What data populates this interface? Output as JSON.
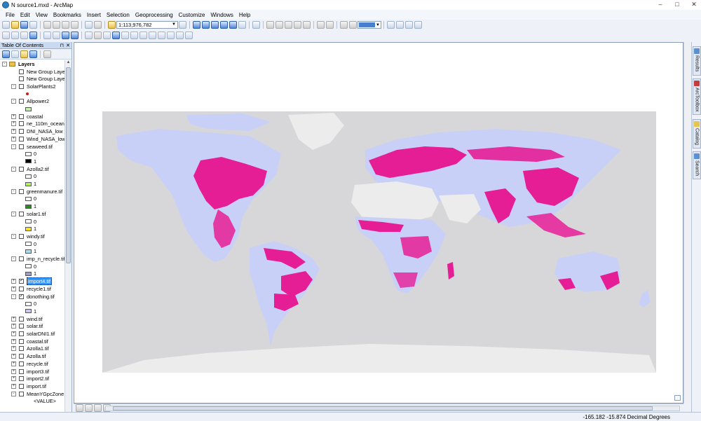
{
  "window": {
    "title": "N source1.mxd - ArcMap",
    "icon": "arcmap-globe-icon"
  },
  "menu": [
    "File",
    "Edit",
    "View",
    "Bookmarks",
    "Insert",
    "Selection",
    "Geoprocessing",
    "Customize",
    "Windows",
    "Help"
  ],
  "toolbar": {
    "scale_value": "1:113,976,782",
    "fill_color": "#4a7fd0"
  },
  "toc": {
    "title": "Table Of Contents",
    "root_label": "Layers",
    "rows": [
      {
        "type": "layer",
        "label": "New Group Layer",
        "checked": false,
        "expander": ""
      },
      {
        "type": "layer",
        "label": "New Group Layer",
        "checked": false,
        "expander": ""
      },
      {
        "type": "layer",
        "label": "SolarPlants2",
        "checked": false,
        "expander": "-"
      },
      {
        "type": "point",
        "color": "#c81e1e"
      },
      {
        "type": "layer",
        "label": "Allpower2",
        "checked": false,
        "expander": "-"
      },
      {
        "type": "swatch",
        "color": "#bff0b0",
        "label": ""
      },
      {
        "type": "layer",
        "label": "coastal",
        "checked": false,
        "expander": "+"
      },
      {
        "type": "layer",
        "label": "ne_110m_ocean",
        "checked": false,
        "expander": "+"
      },
      {
        "type": "layer",
        "label": "DNI_NASA_low",
        "checked": false,
        "expander": "+"
      },
      {
        "type": "layer",
        "label": "Wind_NASA_low",
        "checked": false,
        "expander": "+"
      },
      {
        "type": "layer",
        "label": "seaweed.tif",
        "checked": false,
        "expander": "-"
      },
      {
        "type": "swatch",
        "color": "#ffffff",
        "label": "0"
      },
      {
        "type": "swatch",
        "color": "#000000",
        "label": "1"
      },
      {
        "type": "layer",
        "label": "Azolla2.tif",
        "checked": false,
        "expander": "-"
      },
      {
        "type": "swatch",
        "color": "#ffffff",
        "label": "0"
      },
      {
        "type": "swatch",
        "color": "#b4f064",
        "label": "1"
      },
      {
        "type": "layer",
        "label": "greenmanure.tif",
        "checked": false,
        "expander": "-"
      },
      {
        "type": "swatch",
        "color": "#ffffff",
        "label": "0"
      },
      {
        "type": "swatch",
        "color": "#2a8c1e",
        "label": "1"
      },
      {
        "type": "layer",
        "label": "solar1.tif",
        "checked": false,
        "expander": "-"
      },
      {
        "type": "swatch",
        "color": "#ffffff",
        "label": "0"
      },
      {
        "type": "swatch",
        "color": "#f5e614",
        "label": "1"
      },
      {
        "type": "layer",
        "label": "windy.tif",
        "checked": false,
        "expander": "-"
      },
      {
        "type": "swatch",
        "color": "#ffffff",
        "label": "0"
      },
      {
        "type": "swatch",
        "color": "#a8dcf0",
        "label": "1"
      },
      {
        "type": "layer",
        "label": "imp_n_recycle.tif",
        "checked": false,
        "expander": "-"
      },
      {
        "type": "swatch",
        "color": "#ffffff",
        "label": "0"
      },
      {
        "type": "swatch",
        "color": "#a09cc8",
        "label": "1"
      },
      {
        "type": "layer",
        "label": "import4.tif",
        "checked": true,
        "expander": "+",
        "selected": true
      },
      {
        "type": "layer",
        "label": "recycle1.tif",
        "checked": false,
        "expander": "+"
      },
      {
        "type": "layer",
        "label": "donothing.tif",
        "checked": true,
        "expander": "-"
      },
      {
        "type": "swatch",
        "color": "#ffffff",
        "label": "0"
      },
      {
        "type": "swatch",
        "color": "#c8c8f0",
        "label": "1"
      },
      {
        "type": "layer",
        "label": "wind.tif",
        "checked": false,
        "expander": "+"
      },
      {
        "type": "layer",
        "label": "solar.tif",
        "checked": false,
        "expander": "+"
      },
      {
        "type": "layer",
        "label": "solarDNI1.tif",
        "checked": false,
        "expander": "+"
      },
      {
        "type": "layer",
        "label": "coastal.tif",
        "checked": false,
        "expander": "+"
      },
      {
        "type": "layer",
        "label": "Azolla1.tif",
        "checked": false,
        "expander": "+"
      },
      {
        "type": "layer",
        "label": "Azolla.tif",
        "checked": false,
        "expander": "+"
      },
      {
        "type": "layer",
        "label": "recycle.tif",
        "checked": false,
        "expander": "+"
      },
      {
        "type": "layer",
        "label": "import3.tif",
        "checked": false,
        "expander": "+"
      },
      {
        "type": "layer",
        "label": "import2.tif",
        "checked": false,
        "expander": "+"
      },
      {
        "type": "layer",
        "label": "import.tif",
        "checked": false,
        "expander": "+"
      },
      {
        "type": "layer",
        "label": "MeanYGpcZone",
        "checked": false,
        "expander": "-"
      },
      {
        "type": "text",
        "label": "<VALUE>"
      }
    ]
  },
  "map": {
    "background": "#d7d7d9",
    "land_color": "#c8d0f8",
    "pink_color": "#e61e96",
    "desert_color": "#ececec"
  },
  "right_dock": [
    "Results",
    "ArcToolbox",
    "Catalog",
    "Search"
  ],
  "status": {
    "coordinates": "-165.182  -15.874 Decimal Degrees"
  }
}
